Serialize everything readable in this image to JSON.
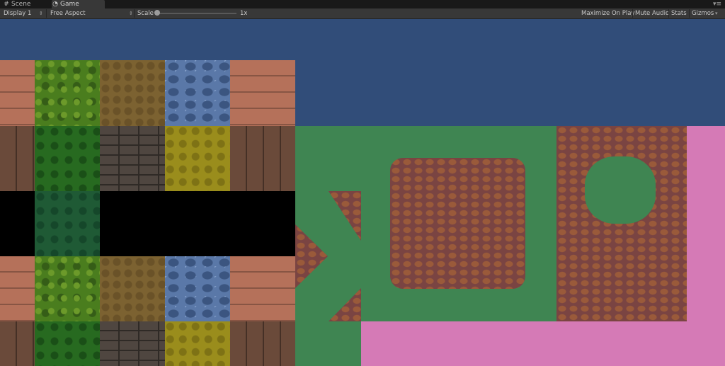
{
  "tabs": [
    {
      "label": "Scene",
      "icon": "grid-icon"
    },
    {
      "label": "Game",
      "icon": "pacman-icon",
      "active": true
    }
  ],
  "toolbar": {
    "display": "Display 1",
    "aspect": "Free Aspect",
    "scale_label": "Scale",
    "scale_value": "1x",
    "scale_fraction": 0.0,
    "maximize": "Maximize On Play",
    "mute": "Mute Audio",
    "stats": "Stats",
    "gizmos": "Gizmos"
  },
  "colors": {
    "background": "#314d79",
    "grass_field": "#3f8552",
    "rock": "#7a4442",
    "pink": "#d57ab6"
  },
  "tiles": [
    "wood",
    "grass",
    "dirt",
    "water",
    "wood",
    "darkwood",
    "dgrass",
    "brick",
    "ygrass",
    "darkwood",
    "black",
    "tgrass",
    "black",
    "black",
    "black",
    "wood",
    "grass",
    "dirt",
    "water",
    "wood",
    "darkwood",
    "dgrass",
    "brick",
    "ygrass",
    "darkwood"
  ]
}
